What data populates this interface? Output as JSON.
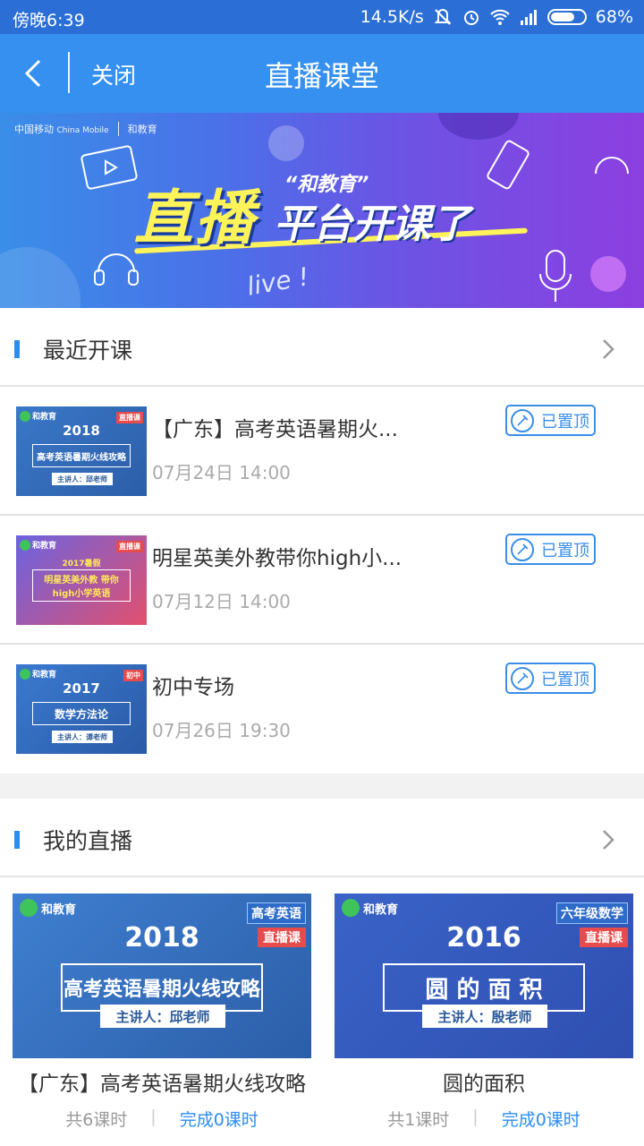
{
  "status_bar": {
    "time": "傍晚6:39",
    "speed": "14.5K/s",
    "battery": "68%",
    "icons": [
      "mute-icon",
      "alarm-icon",
      "wifi-icon",
      "signal-icon",
      "battery-icon"
    ]
  },
  "header": {
    "close_label": "关闭",
    "title": "直播课堂"
  },
  "banner": {
    "logo_left": "中国移动",
    "logo_left_en": "China Mobile",
    "logo_right": "和教育",
    "quote": "“和教育”",
    "big_text": "直播",
    "sub_text": "平台开课了",
    "live": "live !"
  },
  "recent": {
    "title": "最近开课",
    "items": [
      {
        "title": "【广东】高考英语暑期火...",
        "time": "07月24日 14:00",
        "badge": "已置顶",
        "thumb": {
          "year": "2018",
          "tag": "直播课",
          "box": "高考英语暑期火线攻略",
          "speaker": "主讲人：邱老师",
          "logo": "和教育"
        }
      },
      {
        "title": "明星英美外教带你high小...",
        "time": "07月12日 14:00",
        "badge": "已置顶",
        "thumb": {
          "year": "2017暑假",
          "tag": "直播课",
          "box": "明星英美外教 带你high小学英语",
          "speaker": "",
          "logo": "和教育"
        }
      },
      {
        "title": "初中专场",
        "time": "07月26日 19:30",
        "badge": "已置顶",
        "thumb": {
          "year": "2017",
          "tag": "初中",
          "box": "数学方法论",
          "speaker": "主讲人：谭老师",
          "logo": "和教育"
        }
      }
    ]
  },
  "mylive": {
    "title": "我的直播",
    "cards": [
      {
        "img": {
          "logo": "和教育",
          "tag1": "高考英语",
          "tag2": "直播课",
          "year": "2018",
          "box": "高考英语暑期火线攻略",
          "speaker": "主讲人：邱老师"
        },
        "title": "【广东】高考英语暑期火线攻略",
        "total": "共6课时",
        "done": "完成0课时"
      },
      {
        "img": {
          "logo": "和教育",
          "tag1": "六年级数学",
          "tag2": "直播课",
          "year": "2016",
          "box": "圆 的 面 积",
          "speaker": "主讲人：殷老师"
        },
        "title": "圆的面积",
        "total": "共1课时",
        "done": "完成0课时"
      }
    ]
  },
  "colors": {
    "status_bar": "#2b6fd6",
    "header": "#3690f0",
    "accent": "#2d8cf0",
    "badge": "#3a8ee8"
  }
}
